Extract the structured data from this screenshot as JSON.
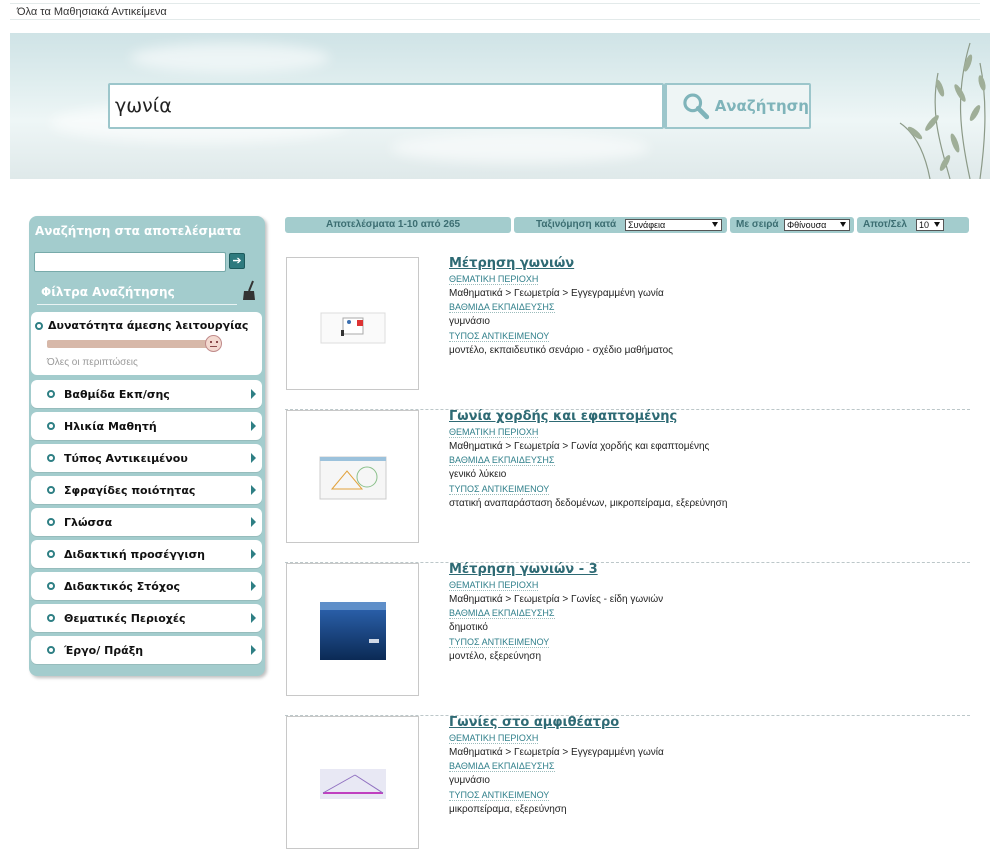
{
  "breadcrumb": "Όλα τα Μαθησιακά Αντικείμενα",
  "search": {
    "value": "γωνία",
    "button_label": "Αναζήτηση",
    "icon": "search-icon"
  },
  "sidebar": {
    "title": "Αναζήτηση στα αποτελέσματα",
    "filters_title": "Φίλτρα Αναζήτησης",
    "live": {
      "label": "Δυνατότητα άμεσης λειτουργίας",
      "sub": "Όλες οι περιπτώσεις"
    },
    "facets": [
      "Βαθμίδα Εκπ/σης",
      "Ηλικία Μαθητή",
      "Τύπος Αντικειμένου",
      "Σφραγίδες ποιότητας",
      "Γλώσσα",
      "Διδακτική προσέγγιση",
      "Διδακτικός Στόχος",
      "Θεματικές Περιοχές",
      "Έργο/ Πράξη"
    ]
  },
  "toolbar": {
    "results_text": "Αποτελέσματα 1-10 από 265",
    "sort_label": "Ταξινόμηση κατά",
    "sort_value": "Συνάφεια",
    "order_label": "Με σειρά",
    "order_value": "Φθίνουσα",
    "per_page_label": "Αποτ/Σελ",
    "per_page_value": "10"
  },
  "field_labels": {
    "area": "ΘΕΜΑΤΙΚΗ ΠΕΡΙΟΧΗ",
    "level": "ΒΑΘΜΙΔΑ ΕΚΠΑΙΔΕΥΣΗΣ",
    "type": "ΤΥΠΟΣ ΑΝΤΙΚΕΙΜΕΝΟΥ"
  },
  "results": [
    {
      "title": "Μέτρηση γωνιών",
      "area": "Μαθηματικά > Γεωμετρία > Εγγεγραμμένη γωνία",
      "level": "γυμνάσιο",
      "type": "μοντέλο, εκπαιδευτικό σενάριο - σχέδιο μαθήματος"
    },
    {
      "title": "Γωνία χορδής και εφαπτομένης",
      "area": "Μαθηματικά > Γεωμετρία > Γωνία χορδής και εφαπτομένης",
      "level": "γενικό λύκειο",
      "type": "στατική αναπαράσταση δεδομένων, μικροπείραμα, εξερεύνηση"
    },
    {
      "title": "Μέτρηση γωνιών - 3",
      "area": "Μαθηματικά > Γεωμετρία > Γωνίες - είδη γωνιών",
      "level": "δημοτικό",
      "type": "μοντέλο, εξερεύνηση"
    },
    {
      "title": "Γωνίες στο αμφιθέατρο",
      "area": "Μαθηματικά > Γεωμετρία > Εγγεγραμμένη γωνία",
      "level": "γυμνάσιο",
      "type": "μικροπείραμα, εξερεύνηση"
    }
  ]
}
